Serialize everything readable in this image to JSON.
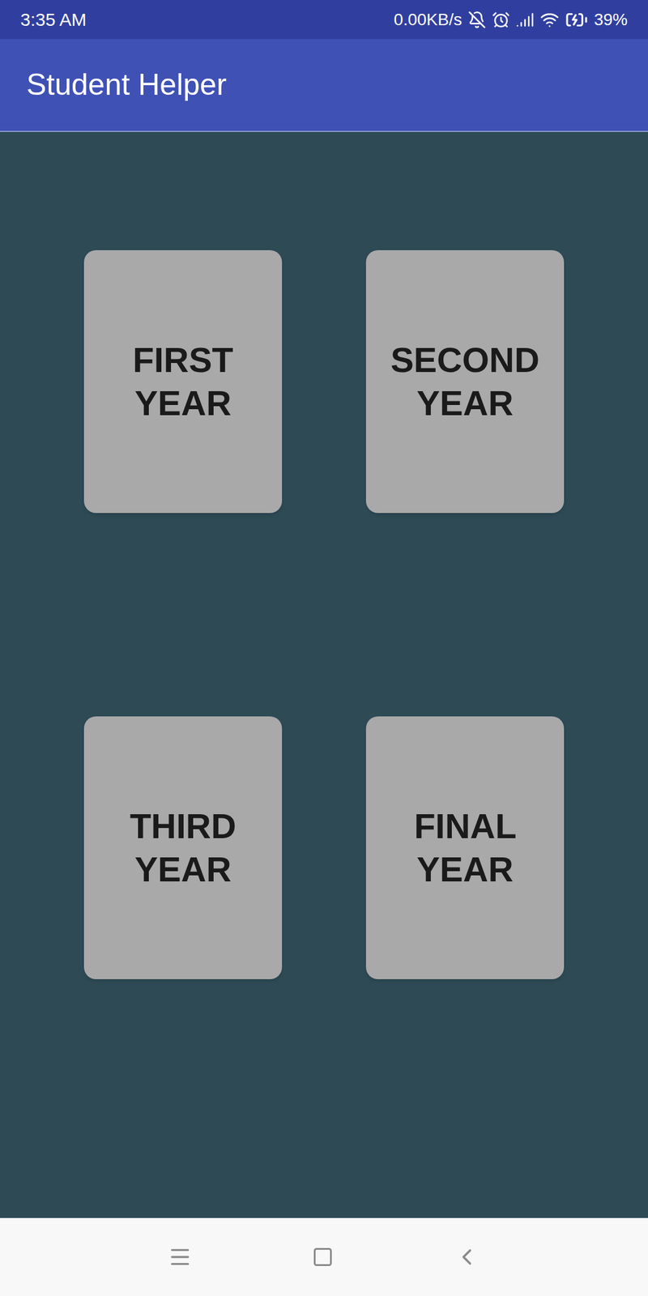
{
  "status_bar": {
    "time": "3:35 AM",
    "network_speed": "0.00KB/s",
    "battery": "39%"
  },
  "app_bar": {
    "title": "Student Helper"
  },
  "cards": [
    {
      "label": "FIRST YEAR"
    },
    {
      "label": "SECOND YEAR"
    },
    {
      "label": "THIRD YEAR"
    },
    {
      "label": "FINAL YEAR"
    }
  ]
}
